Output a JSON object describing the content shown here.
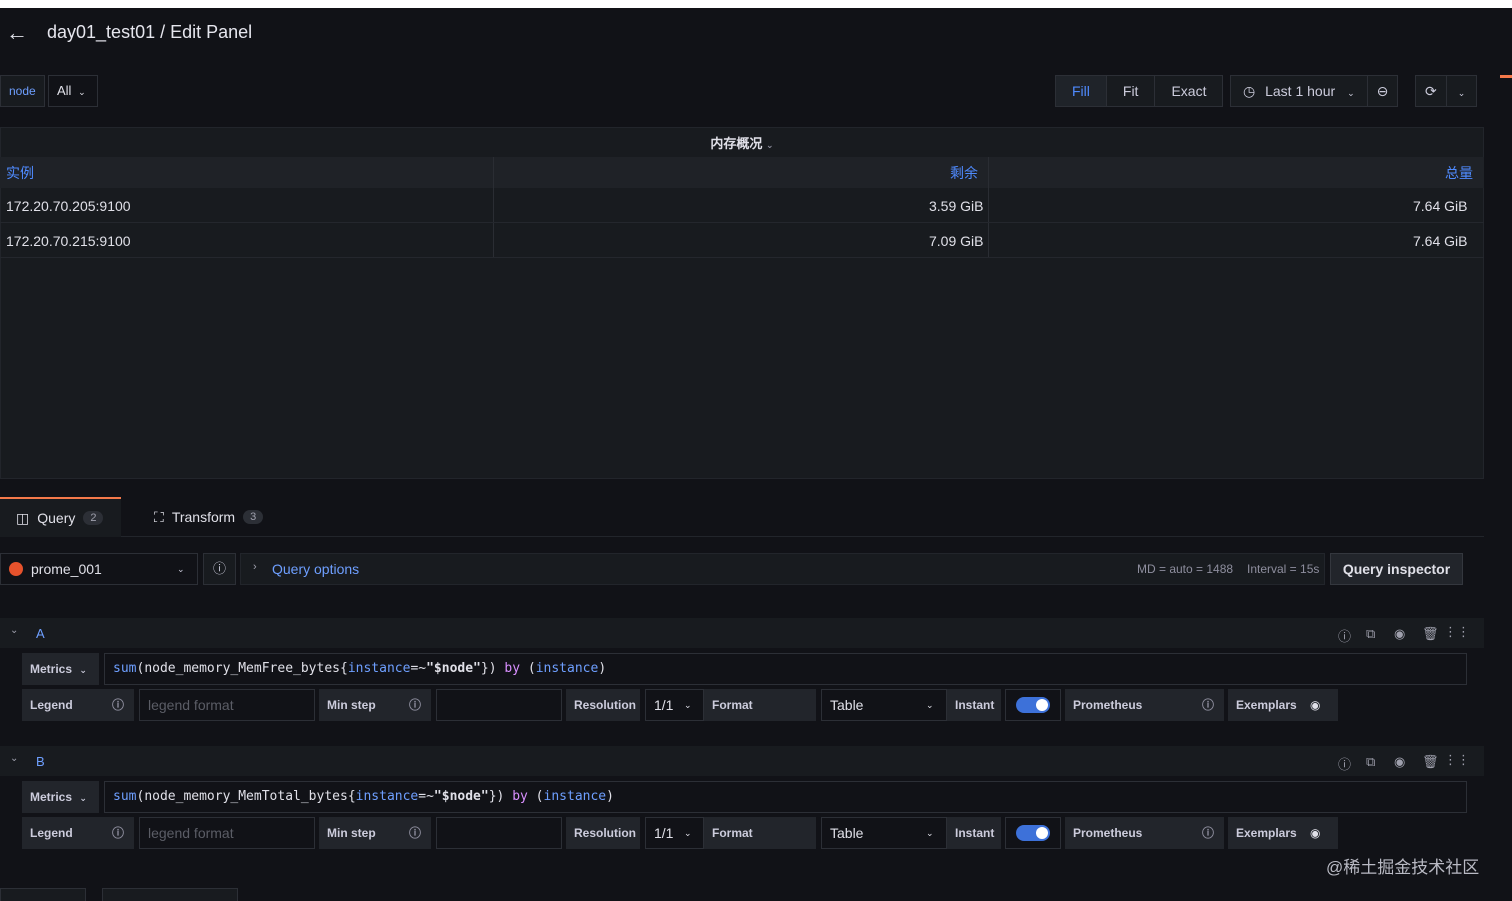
{
  "header": {
    "title": "day01_test01 / Edit Panel"
  },
  "variables": {
    "label": "node",
    "value": "All"
  },
  "view_mode": {
    "fill": "Fill",
    "fit": "Fit",
    "exact": "Exact"
  },
  "time_picker": {
    "label": "Last 1 hour"
  },
  "panel": {
    "title": "内存概况",
    "columns": [
      "实例",
      "剩余",
      "总量"
    ],
    "rows": [
      [
        "172.20.70.205:9100",
        "3.59 GiB",
        "7.64 GiB"
      ],
      [
        "172.20.70.215:9100",
        "7.09 GiB",
        "7.64 GiB"
      ]
    ]
  },
  "tabs": [
    {
      "label": "Query",
      "count": "2"
    },
    {
      "label": "Transform",
      "count": "3"
    }
  ],
  "query_bar": {
    "datasource": "prome_001",
    "query_options": "Query options",
    "md": "MD = auto = 1488",
    "interval": "Interval = 15s",
    "inspector": "Query inspector"
  },
  "queries": [
    {
      "letter": "A",
      "metrics_label": "Metrics",
      "expr": {
        "fn": "sum",
        "metric": "node_memory_MemFree_bytes",
        "label": "instance",
        "op": "=~",
        "value": "\"$node\"",
        "by": "by",
        "group": "instance"
      },
      "legend_label": "Legend",
      "legend_placeholder": "legend format",
      "minstep_label": "Min step",
      "resolution_label": "Resolution",
      "resolution_value": "1/1",
      "format_label": "Format",
      "format_value": "Table",
      "instant_label": "Instant",
      "prometheus_label": "Prometheus",
      "exemplars_label": "Exemplars"
    },
    {
      "letter": "B",
      "metrics_label": "Metrics",
      "expr": {
        "fn": "sum",
        "metric": "node_memory_MemTotal_bytes",
        "label": "instance",
        "op": "=~",
        "value": "\"$node\"",
        "by": "by",
        "group": "instance"
      },
      "legend_label": "Legend",
      "legend_placeholder": "legend format",
      "minstep_label": "Min step",
      "resolution_label": "Resolution",
      "resolution_value": "1/1",
      "format_label": "Format",
      "format_value": "Table",
      "instant_label": "Instant",
      "prometheus_label": "Prometheus",
      "exemplars_label": "Exemplars"
    }
  ],
  "watermark": "@稀土掘金技术社区",
  "colors": {
    "accent": "#4f8bff",
    "active_tab": "#f5794a",
    "background": "#111217"
  }
}
